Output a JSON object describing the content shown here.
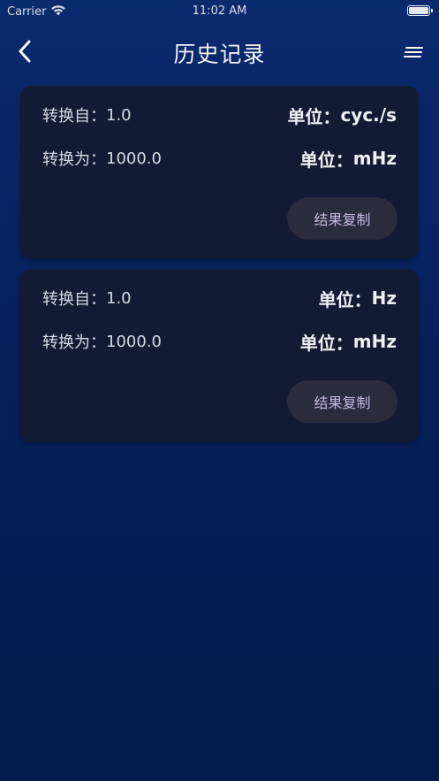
{
  "status_bar": {
    "carrier": "Carrier",
    "time": "11:02 AM"
  },
  "nav": {
    "title": "历史记录",
    "back_icon": "chevron-left-icon",
    "menu_icon": "menu-lines-icon"
  },
  "colors": {
    "background_top": "#0a2a6e",
    "background_bottom": "#031a4c",
    "card": "#131a33",
    "button": "#2a2b3d",
    "button_text": "#c7b8e2"
  },
  "records": [
    {
      "from_label": "转换自：",
      "from_value": "1.0",
      "from_unit_label": "单位：",
      "from_unit": "cyc./s",
      "to_label": "转换为：",
      "to_value": "1000.0",
      "to_unit_label": "单位：",
      "to_unit": "mHz",
      "copy_label": "结果复制"
    },
    {
      "from_label": "转换自：",
      "from_value": "1.0",
      "from_unit_label": "单位：",
      "from_unit": "Hz",
      "to_label": "转换为：",
      "to_value": "1000.0",
      "to_unit_label": "单位：",
      "to_unit": "mHz",
      "copy_label": "结果复制"
    }
  ]
}
